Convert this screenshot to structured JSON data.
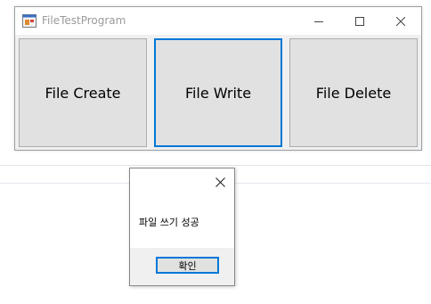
{
  "main_window": {
    "title": "FileTestProgram",
    "buttons": [
      {
        "label": "File Create"
      },
      {
        "label": "File Write"
      },
      {
        "label": "File Delete"
      }
    ]
  },
  "dialog": {
    "message": "파일 쓰기 성공",
    "ok_label": "확인"
  },
  "colors": {
    "focus_accent": "#0078d7",
    "button_face": "#e1e1e1",
    "window_face": "#f0f0f0"
  },
  "icons": {
    "app": "window-app-icon",
    "minimize": "minimize-icon",
    "maximize": "maximize-icon",
    "close": "close-icon"
  }
}
